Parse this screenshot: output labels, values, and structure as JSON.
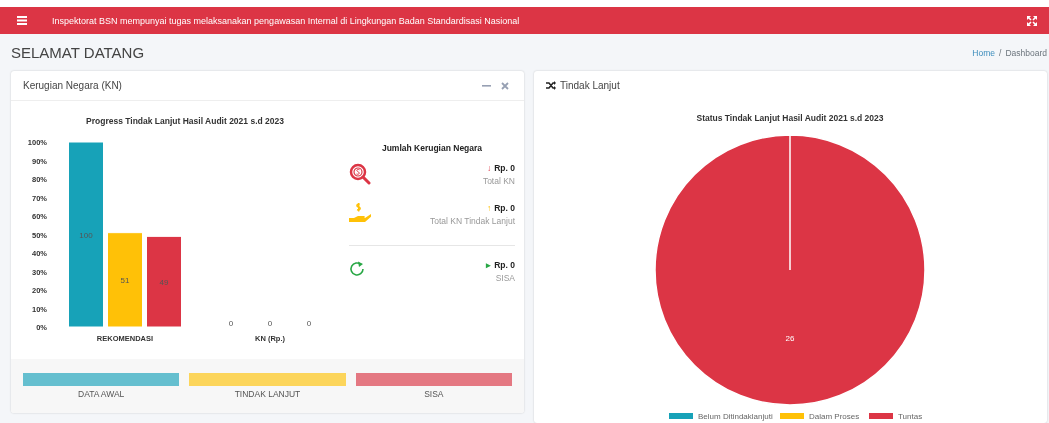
{
  "topbar": {
    "message": "Inspektorat BSN mempunyai tugas melaksanakan pengawasan Internal di Lingkungan Badan Standardisasi Nasional"
  },
  "page": {
    "title": "SELAMAT DATANG",
    "breadcrumb": {
      "separator": "/",
      "items": [
        {
          "label": "Home",
          "selected": false
        },
        {
          "label": "Dashboard",
          "selected": true
        }
      ]
    }
  },
  "kn_card": {
    "title": "Kerugian Negara (KN)",
    "chart_data": {
      "type": "bar",
      "title": "Progress Tindak Lanjut Hasil Audit 2021 s.d 2023",
      "categories": [
        "REKOMENDASI",
        "KN (Rp.)"
      ],
      "ylim": [
        0,
        100
      ],
      "yticks": [
        {
          "value": 0,
          "label": "0%"
        },
        {
          "value": 10,
          "label": "10%"
        },
        {
          "value": 20,
          "label": "20%"
        },
        {
          "value": 30,
          "label": "30%"
        },
        {
          "value": 40,
          "label": "40%"
        },
        {
          "value": 50,
          "label": "50%"
        },
        {
          "value": 60,
          "label": "60%"
        },
        {
          "value": 70,
          "label": "70%"
        },
        {
          "value": 80,
          "label": "80%"
        },
        {
          "value": 90,
          "label": "90%"
        },
        {
          "value": 100,
          "label": "100%"
        }
      ],
      "series": [
        {
          "color": "#17a2b8",
          "values": [
            100,
            0
          ]
        },
        {
          "color": "#ffc107",
          "values": [
            51,
            0
          ]
        },
        {
          "color": "#dc3545",
          "values": [
            49,
            0
          ]
        }
      ],
      "value_labels": [
        [
          "100",
          "0"
        ],
        [
          "51",
          "0"
        ],
        [
          "49",
          "0"
        ]
      ]
    },
    "summary": {
      "title": "Jumlah Kerugian Negara",
      "items": [
        {
          "kind": "loss",
          "arrow": "↓",
          "value": "Rp. 0",
          "label": "Total KN"
        },
        {
          "kind": "payment",
          "arrow": "↑",
          "value": "Rp. 0",
          "label": "Total KN Tindak Lanjut"
        },
        {
          "kind": "remaining",
          "arrow": "▸",
          "value": "Rp. 0",
          "label": "SISA"
        }
      ]
    },
    "footer": [
      {
        "label": "DATA AWAL",
        "color": "#65bfcf"
      },
      {
        "label": "TINDAK LANJUT",
        "color": "#fcd55b"
      },
      {
        "label": "SISA",
        "color": "#e47882"
      }
    ]
  },
  "tl_card": {
    "title": "Tindak Lanjut",
    "chart_data": {
      "type": "pie",
      "title": "Status Tindak Lanjut Hasil Audit 2021 s.d 2023",
      "categories": [
        "Belum Ditindaklanjuti",
        "Dalam Proses",
        "Tuntas"
      ],
      "colors": [
        "#17a2b8",
        "#ffc107",
        "#dc3545"
      ],
      "series": [
        {
          "values": [
            0,
            0,
            100
          ]
        }
      ],
      "value_labels": [
        null,
        null,
        "26"
      ]
    }
  }
}
